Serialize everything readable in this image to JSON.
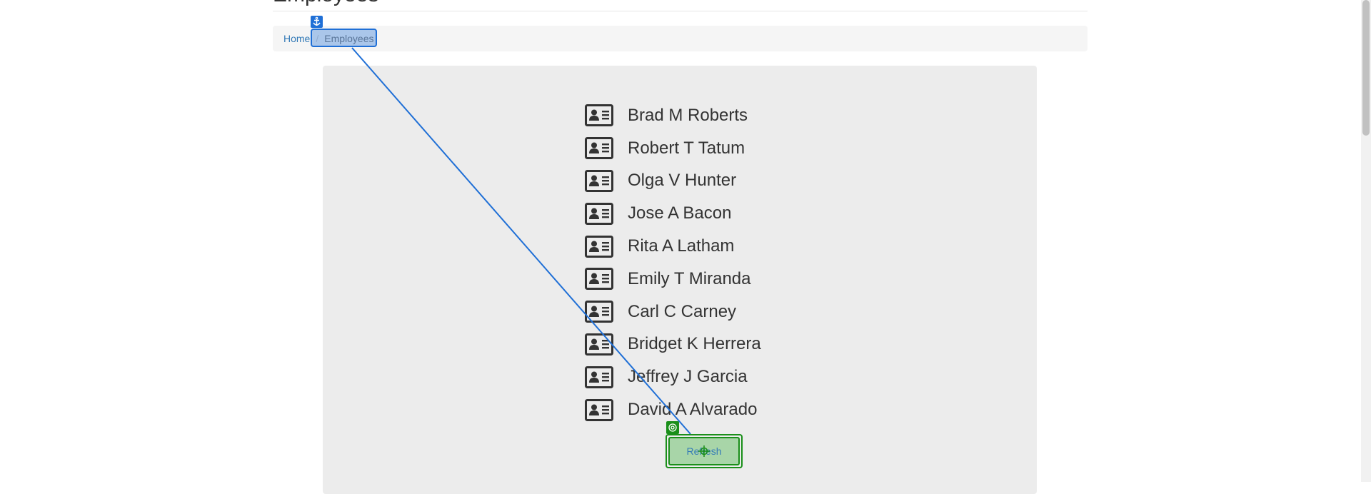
{
  "header": {
    "title": "Employees"
  },
  "breadcrumb": {
    "home": "Home",
    "separator": "/",
    "current": "Employees"
  },
  "employees": [
    {
      "name": "Brad M Roberts"
    },
    {
      "name": "Robert T Tatum"
    },
    {
      "name": "Olga V Hunter"
    },
    {
      "name": "Jose A Bacon"
    },
    {
      "name": "Rita A Latham"
    },
    {
      "name": "Emily T Miranda"
    },
    {
      "name": "Carl C Carney"
    },
    {
      "name": "Bridget K Herrera"
    },
    {
      "name": "Jeffrey J Garcia"
    },
    {
      "name": "David A Alvarado"
    }
  ],
  "actions": {
    "refresh_label": "Refresh"
  },
  "icons": {
    "employee": "id-card-icon",
    "anchor": "anchor-icon",
    "target": "target-icon",
    "crosshair": "crosshair-icon"
  },
  "colors": {
    "anchor_blue": "#1f6fd6",
    "target_green": "#1a8f1a",
    "link": "#337ab7"
  }
}
